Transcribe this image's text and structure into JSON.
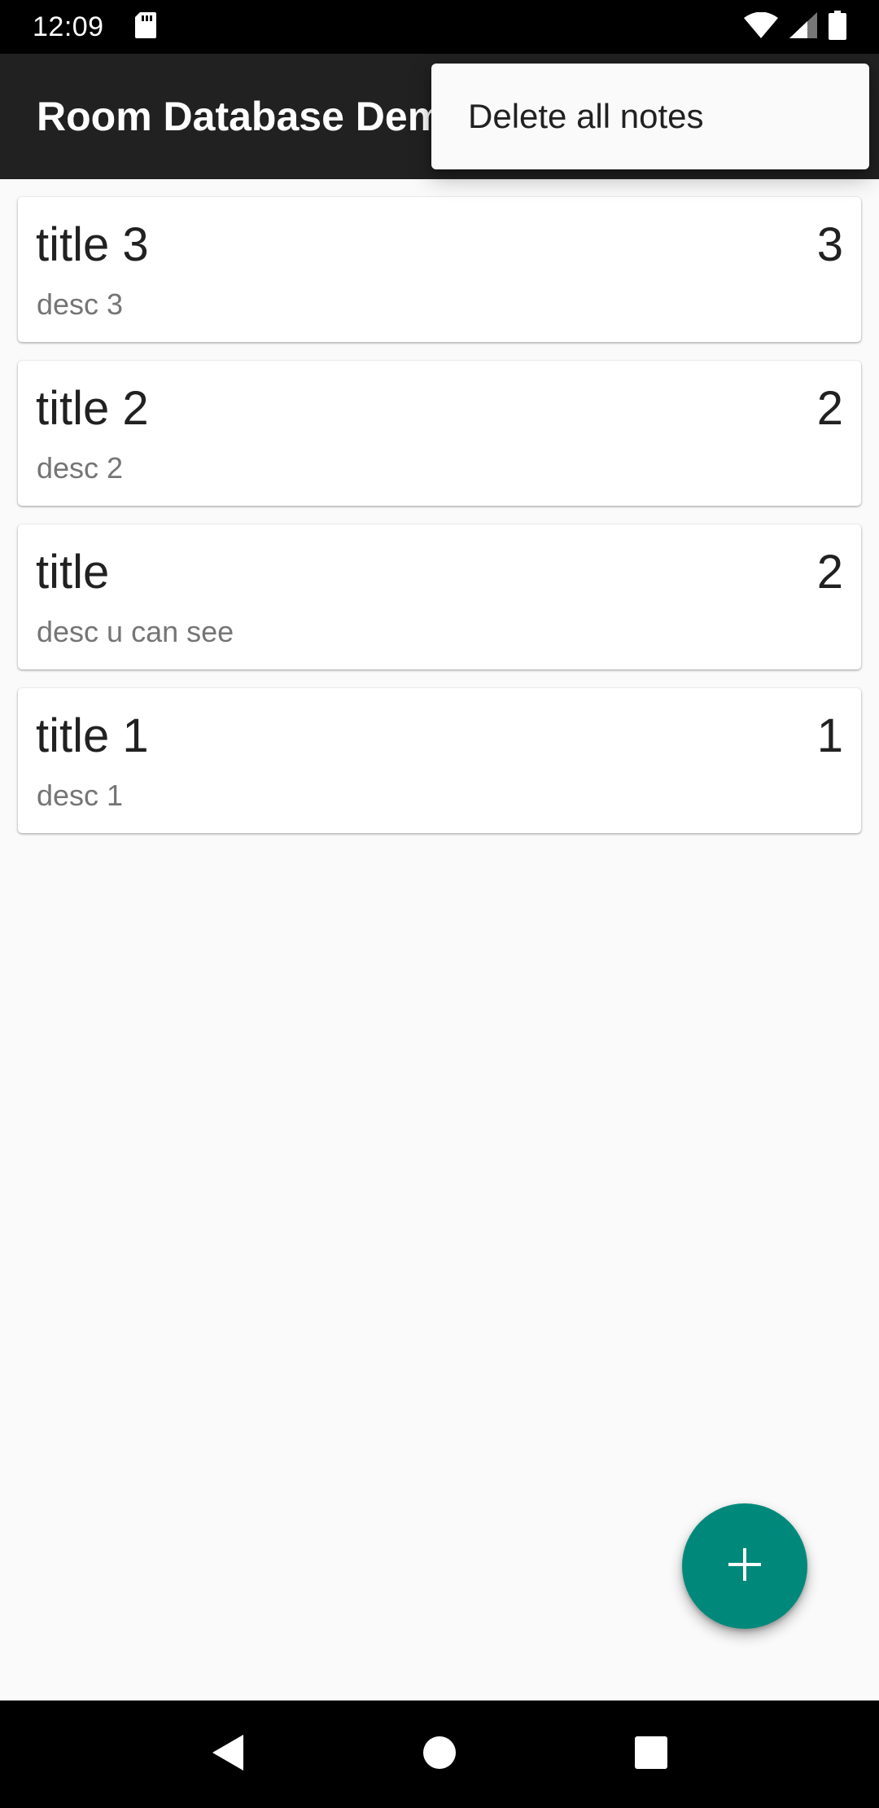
{
  "status_bar": {
    "time": "12:09",
    "icons": [
      "sd-card-icon",
      "wifi-icon",
      "signal-icon",
      "battery-icon"
    ]
  },
  "app_bar": {
    "title": "Room Database Demo"
  },
  "menu": {
    "items": [
      {
        "label": "Delete all notes"
      }
    ]
  },
  "notes": [
    {
      "title": "title 3",
      "description": "desc 3",
      "priority": "3"
    },
    {
      "title": "title 2",
      "description": "desc 2",
      "priority": "2"
    },
    {
      "title": "title",
      "description": "desc u can see",
      "priority": "2"
    },
    {
      "title": "title 1",
      "description": "desc 1",
      "priority": "1"
    }
  ],
  "fab": {
    "icon": "add-icon"
  },
  "nav_bar": {
    "icons": [
      "back-icon",
      "home-icon",
      "recents-icon"
    ]
  },
  "colors": {
    "app_bar": "#212121",
    "accent": "#00897b",
    "background": "#fafafa"
  }
}
